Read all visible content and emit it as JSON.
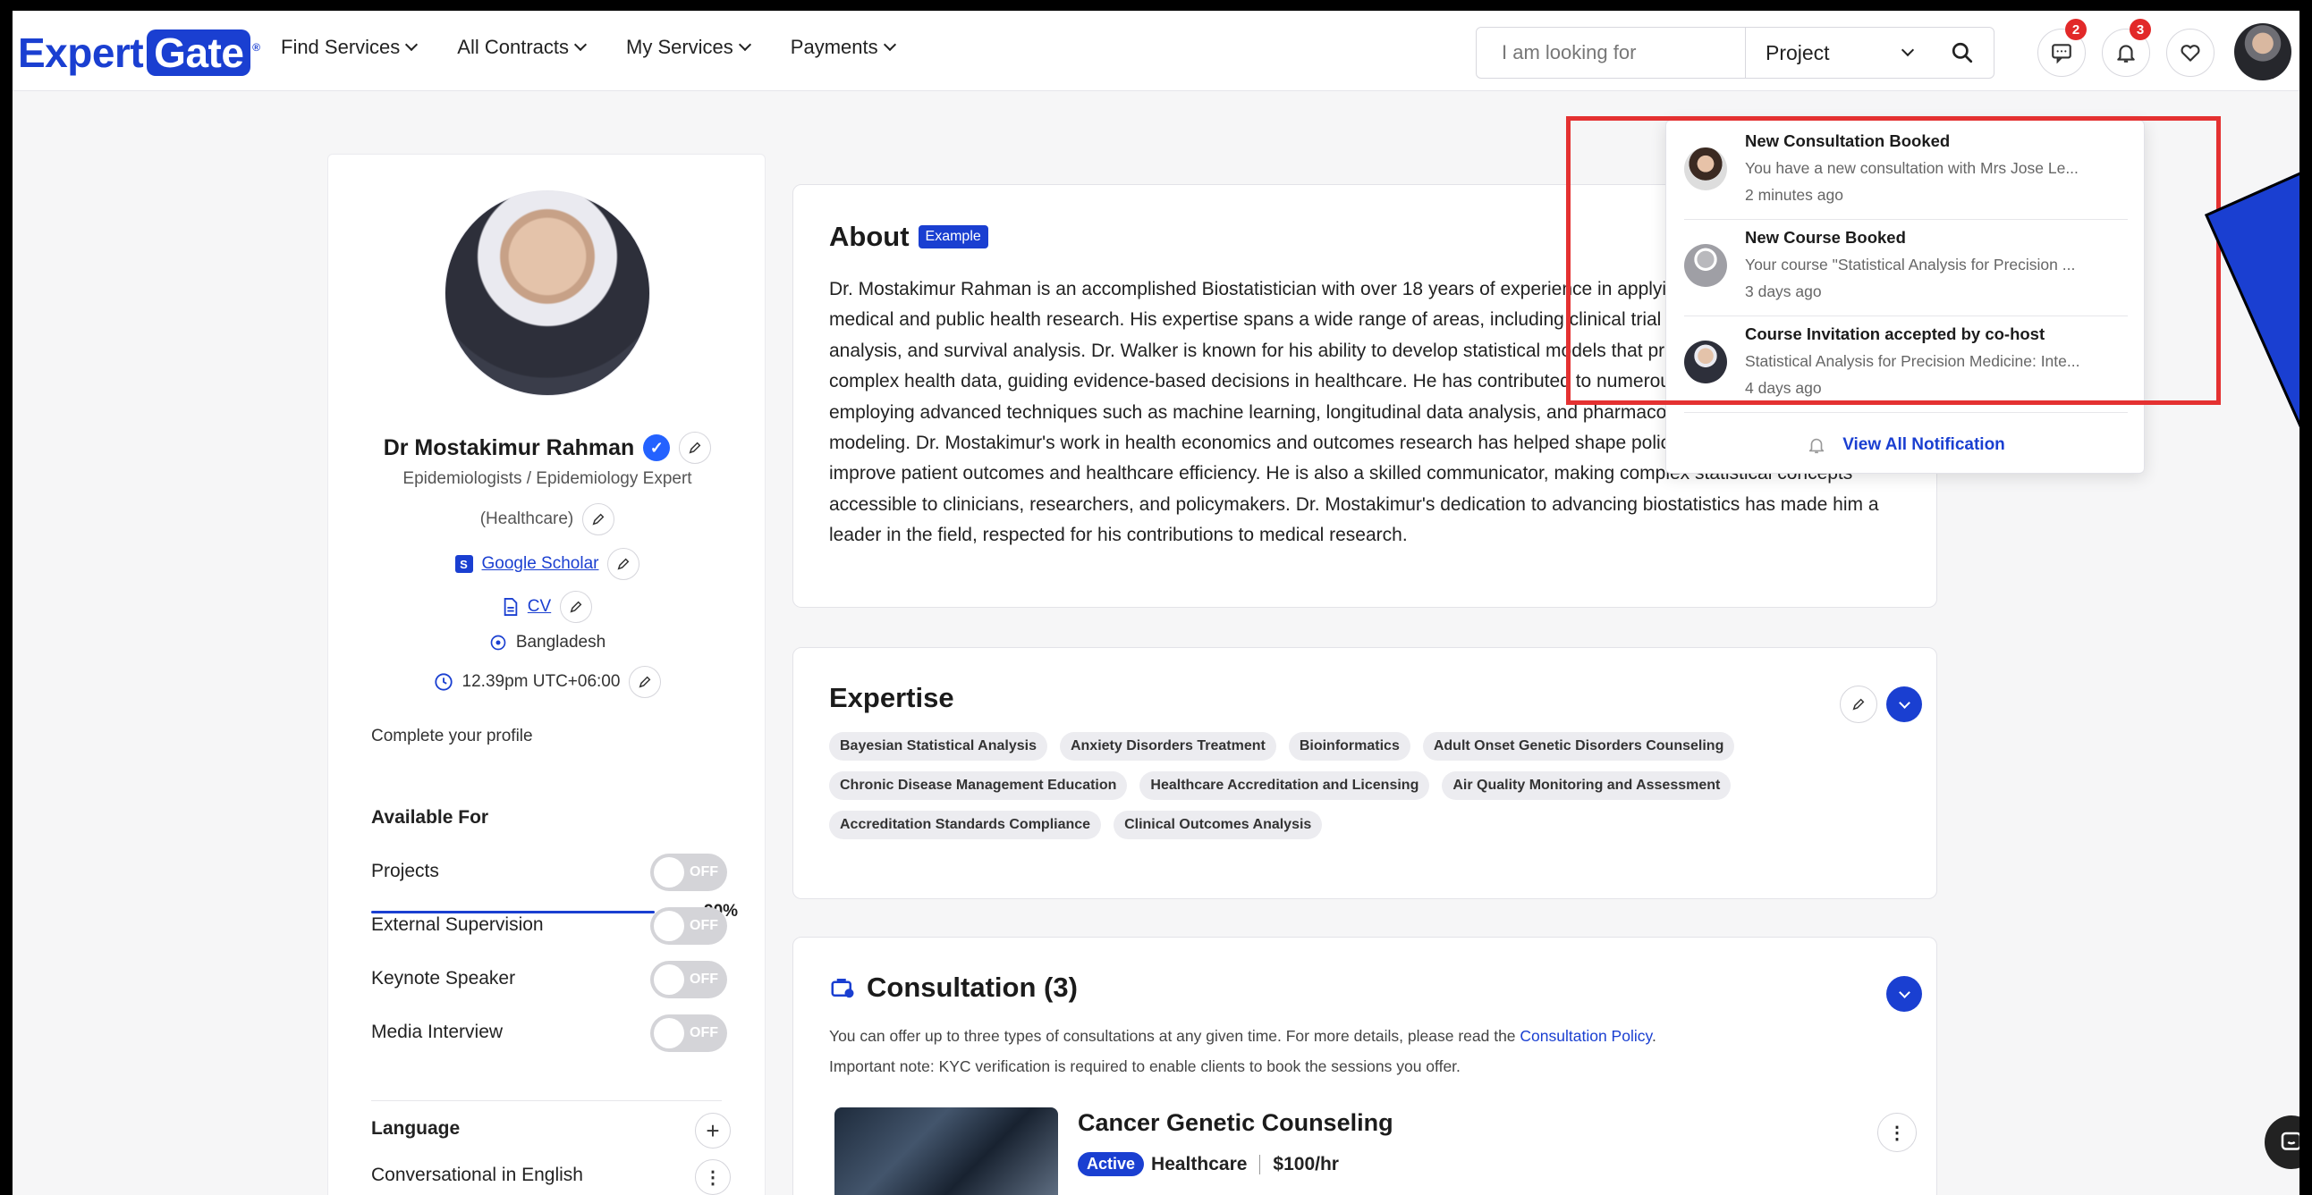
{
  "header": {
    "logo_part1": "Expert",
    "logo_part2": "Gate",
    "logo_reg": "®",
    "nav": [
      "Find Services",
      "All Contracts",
      "My Services",
      "Payments"
    ],
    "search_placeholder": "I am looking for",
    "search_category": "Project",
    "messages_badge": "2",
    "notifications_badge": "3"
  },
  "profile": {
    "name": "Dr Mostakimur Rahman",
    "title_line1": "Epidemiologists / Epidemiology Expert",
    "title_line2": "(Healthcare)",
    "scholar_label": "Google Scholar",
    "cv_label": "CV",
    "location": "Bangladesh",
    "time": "12.39pm UTC+06:00",
    "complete_label": "Complete your profile",
    "complete_percent_text": "90%",
    "complete_fraction": 0.9,
    "available_for_heading": "Available For",
    "available": [
      {
        "label": "Projects",
        "state": "OFF"
      },
      {
        "label": "External Supervision",
        "state": "OFF"
      },
      {
        "label": "Keynote Speaker",
        "state": "OFF"
      },
      {
        "label": "Media Interview",
        "state": "OFF"
      }
    ],
    "language_heading": "Language",
    "language_value": "Conversational in English"
  },
  "about": {
    "title": "About",
    "tag": "Example",
    "body": "Dr. Mostakimur Rahman is an accomplished Biostatistician with over 18 years of experience in applying statistical methods to medical and public health research. His expertise spans a wide range of areas, including clinical trial design, Bayesian statistical analysis, and survival analysis. Dr. Walker is known for his ability to develop statistical models that provide critical insights into complex health data, guiding evidence-based decisions in healthcare. He has contributed to numerous high-impact studies, employing advanced techniques such as machine learning, longitudinal data analysis, and pharmacokinetic/pharmacodynamic modeling. Dr. Mostakimur's work in health economics and outcomes research has helped shape policies and practices that improve patient outcomes and healthcare efficiency. He is also a skilled communicator, making complex statistical concepts accessible to clinicians, researchers, and policymakers. Dr. Mostakimur's dedication to advancing biostatistics has made him a leader in the field, respected for his contributions to medical research."
  },
  "expertise": {
    "title": "Expertise",
    "chips": [
      "Bayesian Statistical Analysis",
      "Anxiety Disorders Treatment",
      "Bioinformatics",
      "Adult Onset Genetic Disorders Counseling",
      "Chronic Disease Management Education",
      "Healthcare Accreditation and Licensing",
      "Air Quality Monitoring and Assessment",
      "Accreditation Standards Compliance",
      "Clinical Outcomes Analysis"
    ]
  },
  "consultation": {
    "title": "Consultation (3)",
    "note1_prefix": "You can offer up to three types of consultations at any given time. For more details, please read the ",
    "note1_link": "Consultation Policy",
    "note1_suffix": ".",
    "note2": "Important note: KYC verification is required to enable clients to book the sessions you offer.",
    "item": {
      "title": "Cancer Genetic Counseling",
      "status": "Active",
      "category": "Healthcare",
      "rate": "$100/hr"
    }
  },
  "notifications": {
    "items": [
      {
        "title": "New Consultation Booked",
        "message": "You have a new consultation with Mrs Jose Le...",
        "time": "2 minutes ago"
      },
      {
        "title": "New Course Booked",
        "message": "Your course \"Statistical Analysis for Precision ...",
        "time": "3 days ago"
      },
      {
        "title": "Course Invitation accepted by co-host",
        "message": "Statistical Analysis for Precision Medicine: Inte...",
        "time": "4 days ago"
      }
    ],
    "view_all": "View All Notification"
  },
  "colors": {
    "brand": "#1a3fd1",
    "badge": "#e22929",
    "highlight_box": "#e43131"
  }
}
